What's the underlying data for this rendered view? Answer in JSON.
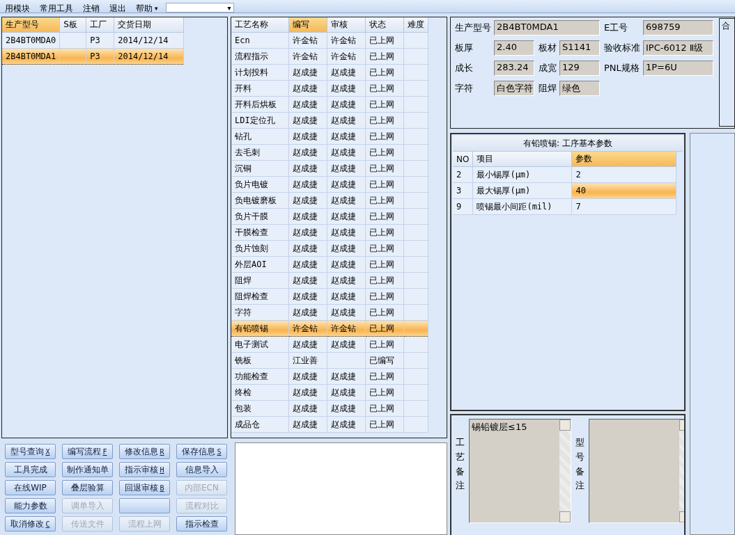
{
  "menu": {
    "items": [
      {
        "label": "用模块",
        "dropdown": false
      },
      {
        "label": "常用工具",
        "dropdown": false
      },
      {
        "label": "注销",
        "dropdown": false
      },
      {
        "label": "退出",
        "dropdown": false
      },
      {
        "label": "帮助",
        "dropdown": true
      }
    ],
    "combo_arrow": "▾",
    "item_arrow": "▾"
  },
  "model_table": {
    "columns": [
      {
        "label": "生产型号",
        "selected": true
      },
      {
        "label": "S板",
        "selected": false
      },
      {
        "label": "工厂",
        "selected": false
      },
      {
        "label": "交货日期",
        "selected": false
      }
    ],
    "rows": [
      {
        "cells": [
          "2B4BT0MDA0",
          "",
          "P3",
          "2014/12/14"
        ],
        "selected": false
      },
      {
        "cells": [
          "2B4BT0MDA1",
          "",
          "P3",
          "2014/12/14"
        ],
        "selected": true
      }
    ]
  },
  "process_table": {
    "columns": [
      {
        "label": "工艺名称",
        "selected": false
      },
      {
        "label": "编写",
        "selected": true
      },
      {
        "label": "审核",
        "selected": false
      },
      {
        "label": "状态",
        "selected": false
      },
      {
        "label": "难度",
        "selected": false
      }
    ],
    "rows": [
      {
        "cells": [
          "Ecn",
          "许金钻",
          "许金钻",
          "已上网",
          ""
        ],
        "selected": false
      },
      {
        "cells": [
          "流程指示",
          "许金钻",
          "许金钻",
          "已上网",
          ""
        ],
        "selected": false
      },
      {
        "cells": [
          "计划投料",
          "赵成捷",
          "赵成捷",
          "已上网",
          ""
        ],
        "selected": false
      },
      {
        "cells": [
          "开料",
          "赵成捷",
          "赵成捷",
          "已上网",
          ""
        ],
        "selected": false
      },
      {
        "cells": [
          "开料后烘板",
          "赵成捷",
          "赵成捷",
          "已上网",
          ""
        ],
        "selected": false
      },
      {
        "cells": [
          "LDI定位孔",
          "赵成捷",
          "赵成捷",
          "已上网",
          ""
        ],
        "selected": false
      },
      {
        "cells": [
          "钻孔",
          "赵成捷",
          "赵成捷",
          "已上网",
          ""
        ],
        "selected": false
      },
      {
        "cells": [
          "去毛刺",
          "赵成捷",
          "赵成捷",
          "已上网",
          ""
        ],
        "selected": false
      },
      {
        "cells": [
          "沉铜",
          "赵成捷",
          "赵成捷",
          "已上网",
          ""
        ],
        "selected": false
      },
      {
        "cells": [
          "负片电镀",
          "赵成捷",
          "赵成捷",
          "已上网",
          ""
        ],
        "selected": false
      },
      {
        "cells": [
          "负电镀磨板",
          "赵成捷",
          "赵成捷",
          "已上网",
          ""
        ],
        "selected": false
      },
      {
        "cells": [
          "负片干膜",
          "赵成捷",
          "赵成捷",
          "已上网",
          ""
        ],
        "selected": false
      },
      {
        "cells": [
          "干膜检查",
          "赵成捷",
          "赵成捷",
          "已上网",
          ""
        ],
        "selected": false
      },
      {
        "cells": [
          "负片蚀刻",
          "赵成捷",
          "赵成捷",
          "已上网",
          ""
        ],
        "selected": false
      },
      {
        "cells": [
          "外层AOI",
          "赵成捷",
          "赵成捷",
          "已上网",
          ""
        ],
        "selected": false
      },
      {
        "cells": [
          "阻焊",
          "赵成捷",
          "赵成捷",
          "已上网",
          ""
        ],
        "selected": false
      },
      {
        "cells": [
          "阻焊检查",
          "赵成捷",
          "赵成捷",
          "已上网",
          ""
        ],
        "selected": false
      },
      {
        "cells": [
          "字符",
          "赵成捷",
          "赵成捷",
          "已上网",
          ""
        ],
        "selected": false
      },
      {
        "cells": [
          "有铅喷锡",
          "许金钻",
          "许金钻",
          "已上网",
          ""
        ],
        "selected": true
      },
      {
        "cells": [
          "电子测试",
          "赵成捷",
          "赵成捷",
          "已上网",
          ""
        ],
        "selected": false
      },
      {
        "cells": [
          "铣板",
          "江业善",
          "",
          "已编写",
          ""
        ],
        "selected": false
      },
      {
        "cells": [
          "功能检查",
          "赵成捷",
          "赵成捷",
          "已上网",
          ""
        ],
        "selected": false
      },
      {
        "cells": [
          "终检",
          "赵成捷",
          "赵成捷",
          "已上网",
          ""
        ],
        "selected": false
      },
      {
        "cells": [
          "包装",
          "赵成捷",
          "赵成捷",
          "已上网",
          ""
        ],
        "selected": false
      },
      {
        "cells": [
          "成品仓",
          "赵成捷",
          "赵成捷",
          "已上网",
          ""
        ],
        "selected": false
      }
    ]
  },
  "buttons": [
    {
      "label": "型号查询",
      "hotkey": "X",
      "disabled": false
    },
    {
      "label": "编写流程",
      "hotkey": "F",
      "disabled": false
    },
    {
      "label": "修改信息",
      "hotkey": "R",
      "disabled": false
    },
    {
      "label": "保存信息",
      "hotkey": "S",
      "disabled": false
    },
    {
      "label": "工具完成",
      "disabled": false
    },
    {
      "label": "制作通知单",
      "disabled": false
    },
    {
      "label": "指示审核",
      "hotkey": "H",
      "disabled": false
    },
    {
      "label": "信息导入",
      "disabled": false
    },
    {
      "label": "在线WIP",
      "disabled": false
    },
    {
      "label": "叠层验算",
      "disabled": false
    },
    {
      "label": "回退审核",
      "hotkey": "B",
      "disabled": false
    },
    {
      "label": "内部ECN",
      "disabled": true
    },
    {
      "label": "能力参数",
      "disabled": false
    },
    {
      "label": "调单导入",
      "disabled": true
    },
    {
      "disabled": false
    },
    {
      "label": "流程对比",
      "disabled": true
    },
    {
      "label": "取消修改",
      "hotkey": "C",
      "disabled": false
    },
    {
      "label": "传送文件",
      "disabled": true
    },
    {
      "label": "流程上网",
      "disabled": true
    },
    {
      "label": "指示检查",
      "disabled": false
    }
  ],
  "info": {
    "fields": [
      {
        "label": "生产型号",
        "value": "2B4BT0MDA1"
      },
      {
        "label": "E工号",
        "value": "698759"
      },
      {
        "label": "板厚",
        "value": "2.40"
      },
      {
        "label": "板材",
        "value": "S1141"
      },
      {
        "label": "验收标准",
        "value": "IPC-6012 Ⅱ级"
      },
      {
        "label": "成长",
        "value": "283.24"
      },
      {
        "label": "成宽",
        "value": "129"
      },
      {
        "label": "PNL规格",
        "value": "1P=6U"
      },
      {
        "label": "字符",
        "value": "白色字符"
      },
      {
        "label": "阻焊",
        "value": "绿色"
      }
    ],
    "side_box_label": "合"
  },
  "params": {
    "title": "有铅喷锡: 工序基本参数",
    "columns": [
      {
        "label": "NO",
        "selected": false
      },
      {
        "label": "项目",
        "selected": false
      },
      {
        "label": "参数",
        "selected": true
      }
    ],
    "rows": [
      {
        "cells": [
          "2",
          "最小锡厚(μm)",
          "2"
        ],
        "selected": false
      },
      {
        "cells": [
          "3",
          "最大锡厚(μm)",
          "40"
        ],
        "selected": true
      },
      {
        "cells": [
          "9",
          "喷锡最小间距(mil)",
          "7"
        ],
        "selected": false
      }
    ]
  },
  "notes": [
    {
      "label": "工艺备注",
      "value": "锡铅镀层≤15"
    },
    {
      "label": "型号备注"
    }
  ]
}
